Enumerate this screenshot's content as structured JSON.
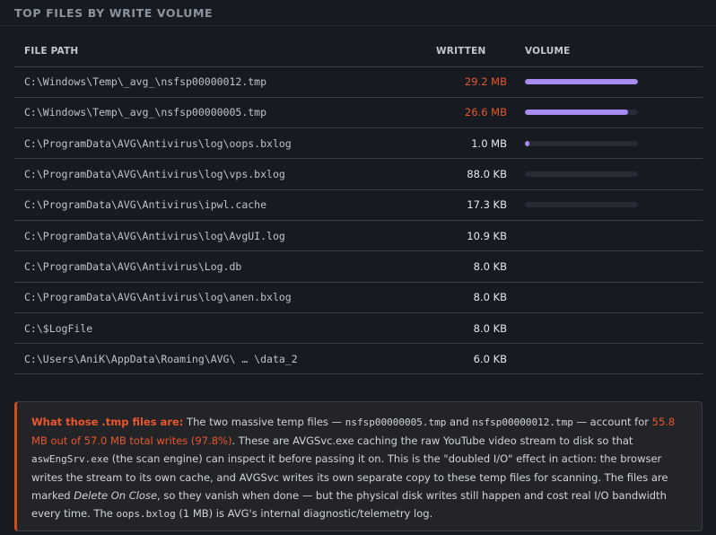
{
  "section": {
    "title": "TOP FILES BY WRITE VOLUME"
  },
  "table": {
    "headers": {
      "path": "FILE PATH",
      "written": "WRITTEN",
      "volume": "VOLUME"
    },
    "rows": [
      {
        "path": "C:\\Windows\\Temp\\_avg_\\nsfsp00000012.tmp",
        "written": "29.2 MB",
        "volume_fraction": 1.0,
        "show_bar": true,
        "highlight": true
      },
      {
        "path": "C:\\Windows\\Temp\\_avg_\\nsfsp00000005.tmp",
        "written": "26.6 MB",
        "volume_fraction": 0.911,
        "show_bar": true,
        "highlight": true
      },
      {
        "path": "C:\\ProgramData\\AVG\\Antivirus\\log\\oops.bxlog",
        "written": "1.0 MB",
        "volume_fraction": 0.034,
        "show_bar": true,
        "highlight": false
      },
      {
        "path": "C:\\ProgramData\\AVG\\Antivirus\\log\\vps.bxlog",
        "written": "88.0 KB",
        "volume_fraction": 0.003,
        "show_bar": true,
        "highlight": false
      },
      {
        "path": "C:\\ProgramData\\AVG\\Antivirus\\ipwl.cache",
        "written": "17.3 KB",
        "volume_fraction": 0.0006,
        "show_bar": true,
        "highlight": false
      },
      {
        "path": "C:\\ProgramData\\AVG\\Antivirus\\log\\AvgUI.log",
        "written": "10.9 KB",
        "volume_fraction": 0,
        "show_bar": false,
        "highlight": false
      },
      {
        "path": "C:\\ProgramData\\AVG\\Antivirus\\Log.db",
        "written": "8.0 KB",
        "volume_fraction": 0,
        "show_bar": false,
        "highlight": false
      },
      {
        "path": "C:\\ProgramData\\AVG\\Antivirus\\log\\anen.bxlog",
        "written": "8.0 KB",
        "volume_fraction": 0,
        "show_bar": false,
        "highlight": false
      },
      {
        "path": "C:\\$LogFile",
        "written": "8.0 KB",
        "volume_fraction": 0,
        "show_bar": false,
        "highlight": false
      },
      {
        "path": "C:\\Users\\AniK\\AppData\\Roaming\\AVG\\ … \\data_2",
        "written": "6.0 KB",
        "volume_fraction": 0,
        "show_bar": false,
        "highlight": false
      }
    ]
  },
  "note": {
    "lead": "What those .tmp files are:",
    "t1": " The two massive temp files — ",
    "c1": "nsfsp00000005.tmp",
    "t2": " and ",
    "c2": "nsfsp00000012.tmp",
    "t3": " — account for ",
    "hl": "55.8 MB out of 57.0 MB total writes (97.8%)",
    "t4": ". These are AVGSvc.exe caching the raw YouTube video stream to disk so that ",
    "c3": "aswEngSrv.exe",
    "t5": " (the scan engine) can inspect it before passing it on. This is the \"doubled I/O\" effect in action: the browser writes the stream to its own cache, and AVGSvc writes its own separate copy to these temp files for scanning. The files are marked ",
    "em": "Delete On Close",
    "t6": ", so they vanish when done — but the physical disk writes still happen and cost real I/O bandwidth every time. The ",
    "c4": "oops.bxlog",
    "t7": " (1 MB) is AVG's internal diagnostic/telemetry log."
  },
  "colors": {
    "accent_orange": "#e8572d",
    "bar_fill": "#a78bf0",
    "bar_track": "#262b36",
    "background": "#171a20"
  }
}
